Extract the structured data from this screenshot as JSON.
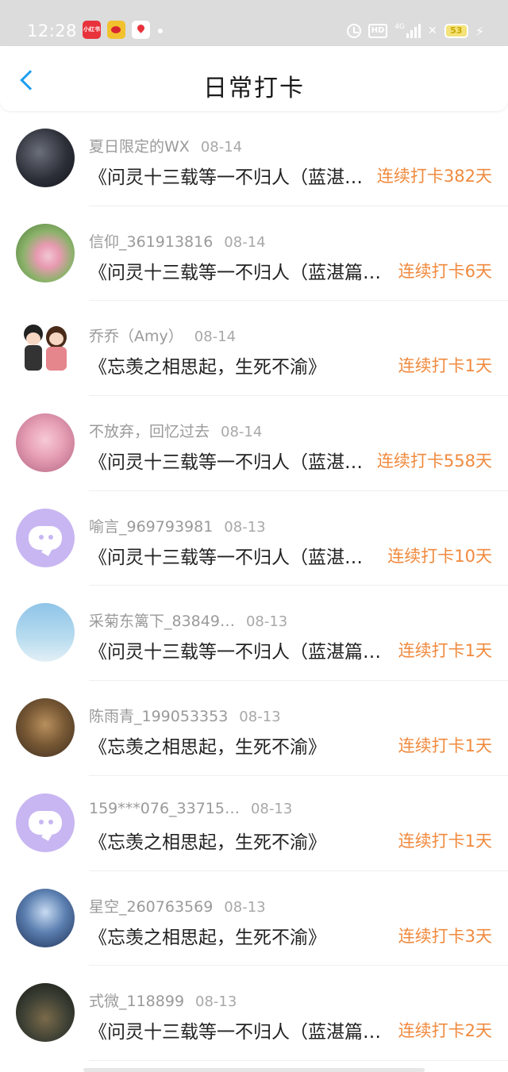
{
  "status_bar": {
    "time": "12:28",
    "app_icons": [
      "xiaohongshu-icon",
      "weibo-icon",
      "map-icon"
    ],
    "hd_label": "HD",
    "network": "4G",
    "battery": "53"
  },
  "header": {
    "title": "日常打卡",
    "back_icon": "chevron-left-icon",
    "accent_color": "#1e9ef0"
  },
  "colors": {
    "streak": "#f08a3e",
    "name": "#9a9a9a"
  },
  "checkins": [
    {
      "name": "夏日限定的WX",
      "date": "08-14",
      "title": "《问灵十三载等一不归人（蓝湛…",
      "streak": "连续打卡382天",
      "avatar": "photo-dark"
    },
    {
      "name": "信仰_361913816",
      "date": "08-14",
      "title": "《问灵十三载等一不归人（蓝湛篇…",
      "streak": "连续打卡6天",
      "avatar": "photo-flowers"
    },
    {
      "name": "乔乔（Amy）",
      "date": "08-14",
      "title": "《忘羡之相思起，生死不渝》",
      "streak": "连续打卡1天",
      "avatar": "photo-cartoon-couple"
    },
    {
      "name": "不放弃，回忆过去",
      "date": "08-14",
      "title": "《问灵十三载等一不归人（蓝湛…",
      "streak": "连续打卡558天",
      "avatar": "photo-pink-blossom"
    },
    {
      "name": "喻言_969793981",
      "date": "08-13",
      "title": "《问灵十三载等一不归人（蓝湛…",
      "streak": "连续打卡10天",
      "avatar": "default"
    },
    {
      "name": "采菊东篱下_83849…",
      "date": "08-13",
      "title": "《问灵十三载等一不归人（蓝湛篇…",
      "streak": "连续打卡1天",
      "avatar": "photo-sky"
    },
    {
      "name": "陈雨青_199053353",
      "date": "08-13",
      "title": "《忘羡之相思起，生死不渝》",
      "streak": "连续打卡1天",
      "avatar": "photo-dog"
    },
    {
      "name": "159***076_33715…",
      "date": "08-13",
      "title": "《忘羡之相思起，生死不渝》",
      "streak": "连续打卡1天",
      "avatar": "default"
    },
    {
      "name": "星空_260763569",
      "date": "08-13",
      "title": "《忘羡之相思起，生死不渝》",
      "streak": "连续打卡3天",
      "avatar": "photo-anime"
    },
    {
      "name": "式微_118899",
      "date": "08-13",
      "title": "《问灵十三载等一不归人（蓝湛篇…",
      "streak": "连续打卡2天",
      "avatar": "photo-dark-scene"
    }
  ]
}
